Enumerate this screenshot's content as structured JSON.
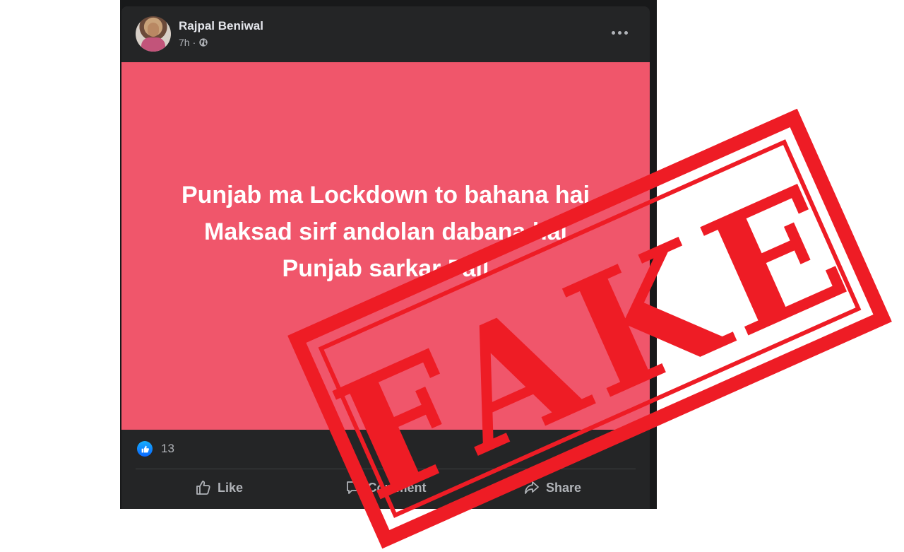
{
  "post": {
    "author": "Rajpal Beniwal",
    "time": "7h",
    "separator": "·",
    "image_text": [
      "Punjab ma Lockdown to bahana hai",
      "Maksad sirf andolan dabana hai",
      "Punjab sarkar Fail"
    ],
    "image_bg": "#f0566b",
    "reaction_count": "13"
  },
  "actions": {
    "like": "Like",
    "comment": "Comment",
    "share": "Share"
  },
  "stamp": {
    "text": "FAKE",
    "color": "#ee1c25"
  },
  "icons": [
    "globe-icon",
    "more-options-icon",
    "like-reaction-icon",
    "thumbs-up-icon",
    "comment-icon",
    "share-icon"
  ]
}
